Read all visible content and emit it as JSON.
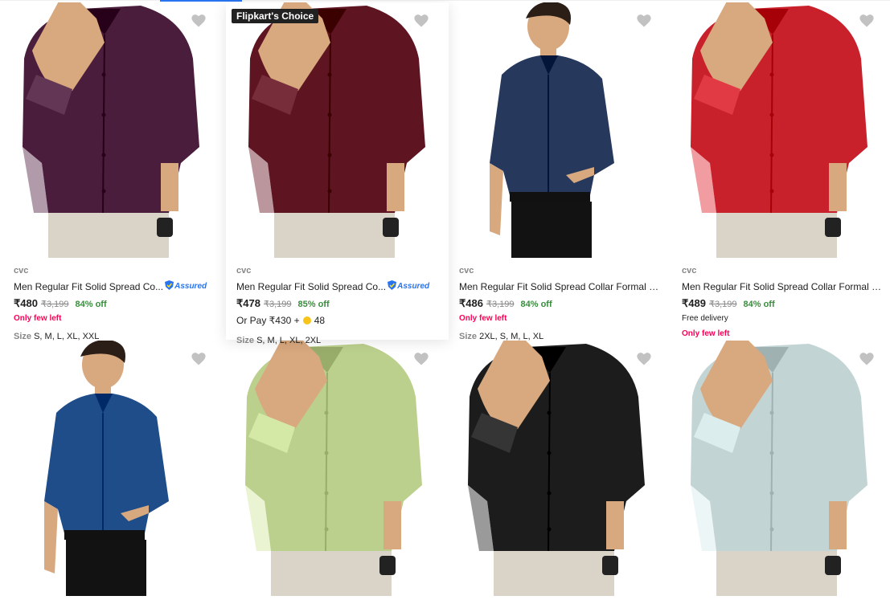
{
  "accent": "#2874f0",
  "rows": [
    [
      {
        "shirt_color": "#4a1d3c",
        "pose": "hand",
        "badge": "",
        "brand": "cvc",
        "title": "Men Regular Fit Solid Spread Co...",
        "assured": true,
        "assured_label": "Assured",
        "price": "₹480",
        "mrp": "₹3,199",
        "discount": "84% off",
        "line2": "",
        "coin_pay": "",
        "coin_value": "",
        "stock": "Only few left",
        "size_label": "Size",
        "sizes": "S, M, L, XL, XXL"
      },
      {
        "shirt_color": "#5e1421",
        "pose": "hand",
        "badge": "Flipkart's Choice",
        "brand": "cvc",
        "title": "Men Regular Fit Solid Spread Co...",
        "assured": true,
        "assured_label": "Assured",
        "price": "₹478",
        "mrp": "₹3,199",
        "discount": "85% off",
        "line2": "",
        "coin_pay": "Or Pay ₹430 +",
        "coin_value": "48",
        "stock": "",
        "size_label": "Size",
        "sizes": "S, M, L, XL, 2XL"
      },
      {
        "shirt_color": "#26385c",
        "pose": "model",
        "badge": "",
        "brand": "cvc",
        "title": "Men Regular Fit Solid Spread Collar Formal S...",
        "assured": false,
        "assured_label": "",
        "price": "₹486",
        "mrp": "₹3,199",
        "discount": "84% off",
        "line2": "",
        "coin_pay": "",
        "coin_value": "",
        "stock": "Only few left",
        "size_label": "Size",
        "sizes": "2XL, S, M, L, XL"
      },
      {
        "shirt_color": "#c9212b",
        "pose": "hand",
        "badge": "",
        "brand": "cvc",
        "title": "Men Regular Fit Solid Spread Collar Formal S...",
        "assured": false,
        "assured_label": "",
        "price": "₹489",
        "mrp": "₹3,199",
        "discount": "84% off",
        "line2": "Free delivery",
        "coin_pay": "",
        "coin_value": "",
        "stock": "Only few left",
        "size_label": "",
        "sizes": ""
      }
    ],
    [
      {
        "shirt_color": "#1f4d8a",
        "pose": "model"
      },
      {
        "shirt_color": "#bcd08e",
        "pose": "hand"
      },
      {
        "shirt_color": "#1c1c1c",
        "pose": "hand"
      },
      {
        "shirt_color": "#c3d4d4",
        "pose": "hand"
      }
    ]
  ]
}
